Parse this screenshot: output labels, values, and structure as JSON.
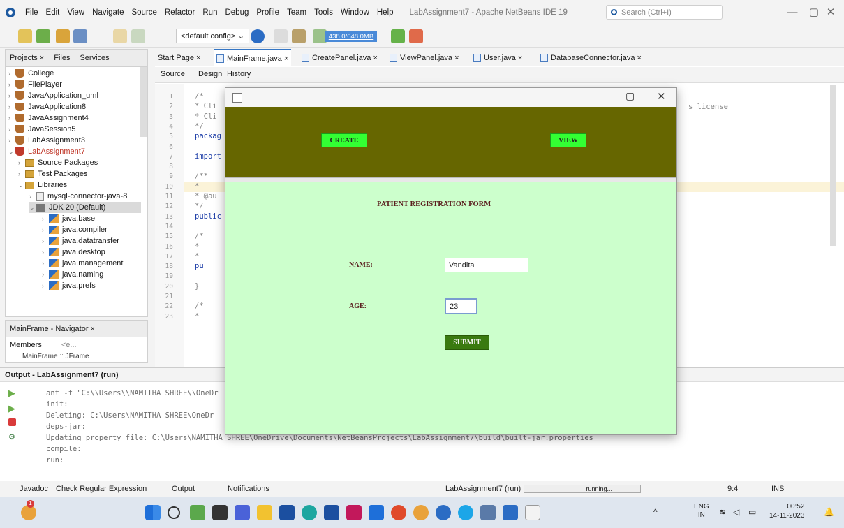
{
  "app": {
    "menu": [
      "File",
      "Edit",
      "View",
      "Navigate",
      "Source",
      "Refactor",
      "Run",
      "Debug",
      "Profile",
      "Team",
      "Tools",
      "Window",
      "Help"
    ],
    "window_title": "LabAssignment7 - Apache NetBeans IDE 19",
    "search_placeholder": "Search (Ctrl+I)"
  },
  "toolbar": {
    "config": "<default config>",
    "memory": "438.0/648.0MB"
  },
  "projects_panel": {
    "tabs": [
      "Projects ×",
      "Files",
      "Services"
    ],
    "items": [
      "College",
      "FilePlayer",
      "JavaApplication_uml",
      "JavaApplication8",
      "JavaAssignment4",
      "JavaSession5",
      "LabAssignment3",
      "LabAssignment7",
      "Source Packages",
      "Test Packages",
      "Libraries",
      "mysql-connector-java-8",
      "JDK 20 (Default)",
      "java.base",
      "java.compiler",
      "java.datatransfer",
      "java.desktop",
      "java.management",
      "java.naming",
      "java.prefs"
    ]
  },
  "navigator": {
    "title": "MainFrame - Navigator ×",
    "members_label": "Members",
    "filter": "<e...",
    "root": "MainFrame :: JFrame"
  },
  "editor": {
    "tabs": [
      "Start Page ×",
      "MainFrame.java ×",
      "CreatePanel.java ×",
      "ViewPanel.java ×",
      "User.java ×",
      "DatabaseConnector.java ×"
    ],
    "subtabs": [
      "Source",
      "Design",
      "History"
    ],
    "line_numbers": [
      "1",
      "2",
      "3",
      "4",
      "5",
      "6",
      "7",
      "8",
      "9",
      "10",
      "11",
      "12",
      "13",
      "14",
      "15",
      "16",
      "17",
      "18",
      "19",
      "20",
      "21",
      "22",
      "23"
    ],
    "code_lines": [
      "/*",
      " * Cli",
      " * Cli",
      " */",
      "packag",
      "",
      "import",
      "",
      "/**",
      " *",
      " * @au",
      " */",
      "public",
      "",
      "    /*",
      "     *",
      "     *",
      "    pu",
      "",
      "    }",
      "",
      "    /*",
      "     *"
    ],
    "license_fragment": "s license"
  },
  "output": {
    "title": "Output - LabAssignment7 (run)",
    "lines": [
      "ant -f \"C:\\\\Users\\\\NAMITHA SHREE\\\\OneDr",
      "init:",
      "Deleting: C:\\Users\\NAMITHA SHREE\\OneDr",
      "deps-jar:",
      "Updating property file: C:\\Users\\NAMITHA SHREE\\OneDrive\\Documents\\NetBeansProjects\\LabAssignment7\\build\\built-jar.properties",
      "compile:",
      "run:"
    ]
  },
  "statusbar": {
    "tabs": [
      "Javadoc",
      "Check Regular Expression",
      "Output",
      "Notifications"
    ],
    "run_label": "LabAssignment7 (run)",
    "progress_text": "running...",
    "position": "9:4",
    "mode": "INS"
  },
  "app_window": {
    "create_label": "CREATE",
    "view_label": "VIEW",
    "form_title": "PATIENT REGISTRATION FORM",
    "name_label": "NAME:",
    "name_value": "Vandita",
    "age_label": "AGE:",
    "age_value": "23",
    "submit_label": "SUBMIT"
  },
  "taskbar": {
    "lang": "ENG",
    "region": "IN",
    "time": "00:52",
    "date": "14-11-2023",
    "badge": "1"
  },
  "colors": {
    "header_olive": "#666600",
    "form_bg": "#ccffcc",
    "button_green": "#33ff33",
    "submit_green": "#3a7a10",
    "label_maroon": "#5a1e1e"
  }
}
